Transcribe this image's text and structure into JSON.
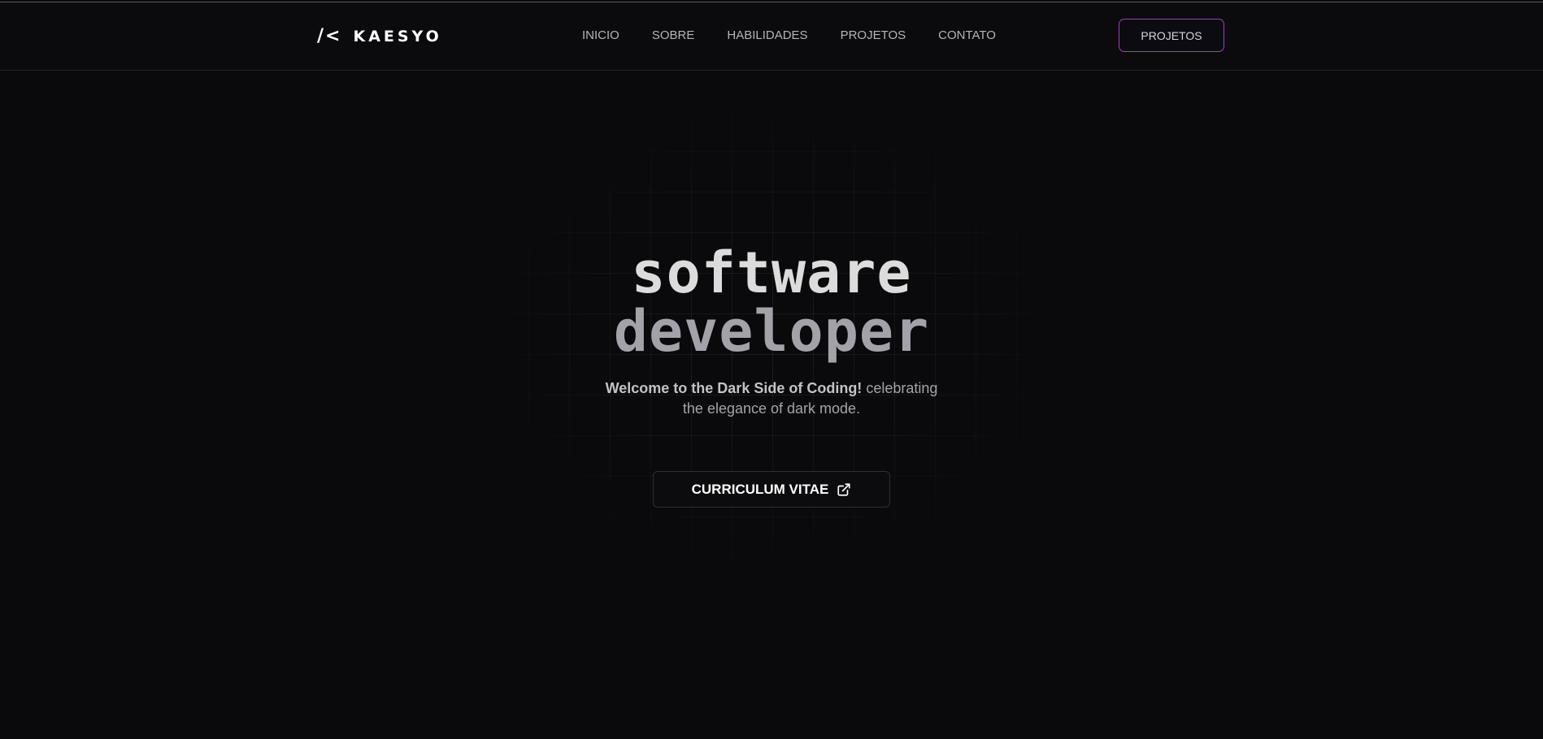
{
  "brand": {
    "logo_mark": "/<",
    "name": "KAESYO"
  },
  "nav": {
    "items": [
      {
        "label": "INICIO"
      },
      {
        "label": "SOBRE"
      },
      {
        "label": "HABILIDADES"
      },
      {
        "label": "PROJETOS"
      },
      {
        "label": "CONTATO"
      }
    ],
    "cta_label": "PROJETOS"
  },
  "hero": {
    "title_line_1": "software",
    "title_line_2": "developer",
    "subtitle_bold": "Welcome to the Dark Side of Coding!",
    "subtitle_rest": " celebrating the elegance of dark mode.",
    "cv_button_label": "CURRICULUM VITAE",
    "cv_icon": "external-link-icon"
  },
  "colors": {
    "background": "#0a0a0c",
    "cta_border": "#a63ac4",
    "nav_text": "#b4b4ba"
  }
}
